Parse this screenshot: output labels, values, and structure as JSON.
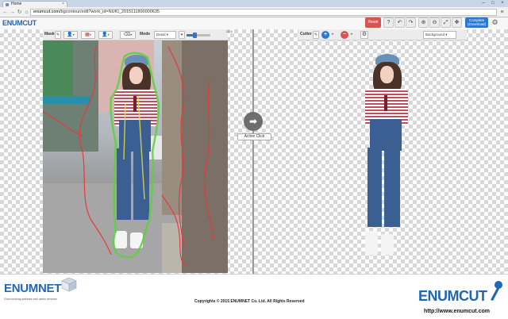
{
  "browser": {
    "tab_title": "Home",
    "tab_close": "×",
    "url_domain": "enumcut.com",
    "url_path": "/bgcontour/edit?work_id=NUKI_2015111800000635",
    "minimize": "–",
    "maximize": "□",
    "close": "×",
    "back": "←",
    "forward": "→",
    "reload": "↻",
    "home": "⌂",
    "menu": "≡"
  },
  "app": {
    "logo_enum": "ENUM",
    "logo_cut": "CUT",
    "reset_label": "Reset",
    "complete_label_1": "Complete",
    "complete_label_2": "(Download)"
  },
  "toolbar_icons": {
    "help": "?",
    "undo": "↶",
    "redo": "↷",
    "zoom_in": "⊕",
    "zoom_out": "⊖",
    "fit": "⤢",
    "move": "✥",
    "gear": "⚙"
  },
  "mask_toolbar": {
    "mask_label": "Mask",
    "mode_label": "Mode",
    "mode_value": "Detail",
    "slider_value": "22.5",
    "slider_fraction": 0.35,
    "caret": "▾"
  },
  "cutter_toolbar": {
    "cutter_label": "Cutter",
    "add": "+",
    "remove": "−",
    "background_label": "Background",
    "caret": "▾"
  },
  "workspace": {
    "active_click_icon": "➡",
    "active_click_label": "Active Click"
  },
  "footer": {
    "enumnet_logo": "ENUMNET",
    "tagline": "Good working   software and useful services",
    "copyright": "Copyrights © 2015 ENUMNET Co. Ltd. All Rights Reserved",
    "enumcut_logo": "ENUMCUT",
    "site_url": "http://www.enumcut.com"
  },
  "colors": {
    "brand_blue": "#1f66b4",
    "reset_red": "#d9534f",
    "complete_blue": "#2a78d2"
  }
}
